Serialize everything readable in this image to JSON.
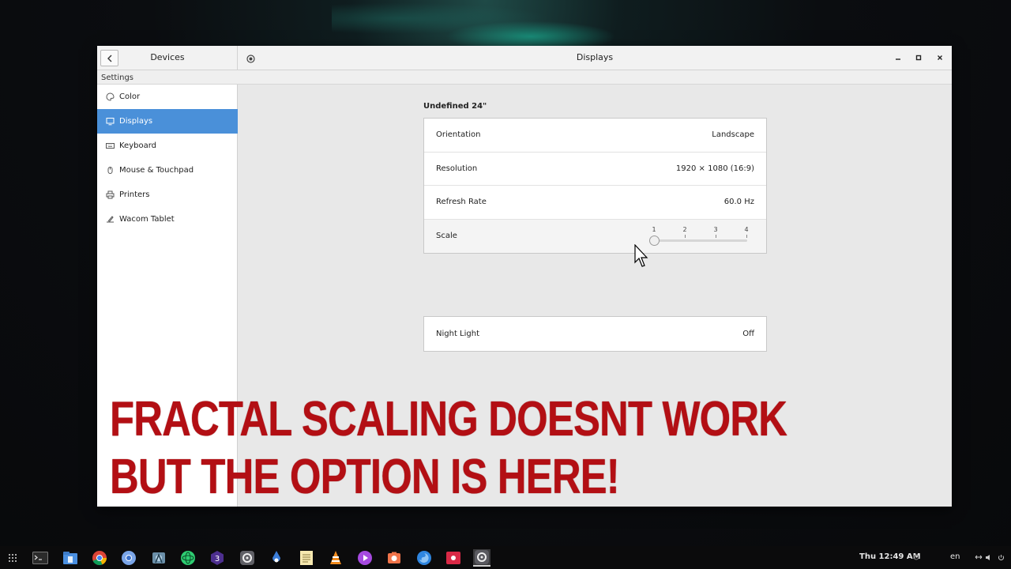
{
  "window": {
    "left_title": "Devices",
    "title": "Displays",
    "breadcrumb": "Settings"
  },
  "sidebar": {
    "items": [
      {
        "label": "Color",
        "icon": "color-icon"
      },
      {
        "label": "Displays",
        "icon": "display-icon",
        "active": true
      },
      {
        "label": "Keyboard",
        "icon": "keyboard-icon"
      },
      {
        "label": "Mouse & Touchpad",
        "icon": "mouse-icon"
      },
      {
        "label": "Printers",
        "icon": "printer-icon"
      },
      {
        "label": "Wacom Tablet",
        "icon": "tablet-icon"
      }
    ]
  },
  "display": {
    "monitor_name": "Undefined 24\"",
    "orientation": {
      "label": "Orientation",
      "value": "Landscape"
    },
    "resolution": {
      "label": "Resolution",
      "value": "1920 × 1080 (16:9)"
    },
    "refresh_rate": {
      "label": "Refresh Rate",
      "value": "60.0 Hz"
    },
    "scale": {
      "label": "Scale",
      "ticks": [
        "1",
        "2",
        "3",
        "4"
      ],
      "value": 1
    },
    "night_light": {
      "label": "Night Light",
      "value": "Off"
    }
  },
  "overlay": {
    "line1": "FRACTAL SCALING DOESNT WORK",
    "line2": "BUT THE OPTION IS HERE!"
  },
  "taskbar": {
    "clock": "Thu 12:49 AM",
    "language": "en",
    "apps": [
      "apps-grid-icon",
      "terminal-icon",
      "files-icon",
      "chrome-icon",
      "chromium-icon",
      "android-studio-icon",
      "atom-icon",
      "blender-icon",
      "settings-icon",
      "inkscape-icon",
      "text-editor-icon",
      "vlc-icon",
      "music-player-icon",
      "screenshot-icon",
      "firefox-icon",
      "screen-recorder-icon",
      "system-settings-icon"
    ]
  },
  "colors": {
    "accent": "#4a90d9",
    "overlay_red": "#b30f14"
  }
}
